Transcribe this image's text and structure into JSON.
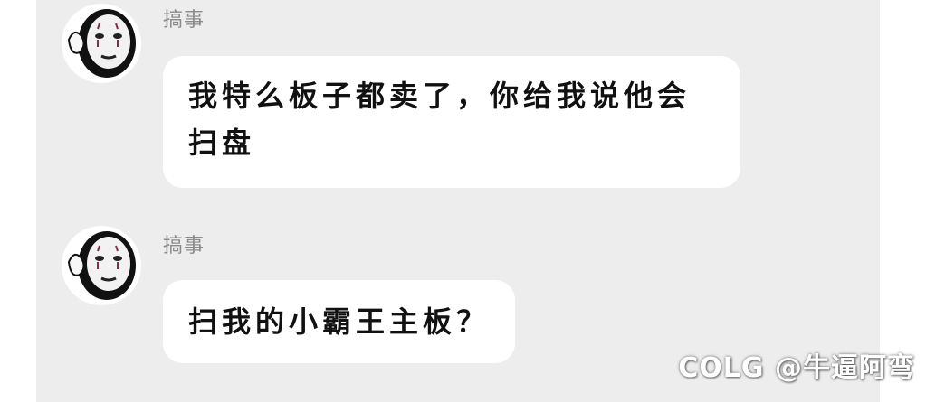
{
  "messages": [
    {
      "sender": "搞事",
      "avatar_icon": "no-face-avatar-icon",
      "text": "我特么板子都卖了，你给我说他会扫盘"
    },
    {
      "sender": "搞事",
      "avatar_icon": "no-face-avatar-icon",
      "text": "扫我的小霸王主板？"
    }
  ],
  "watermark": "COLG @牛逼阿弯",
  "colors": {
    "background": "#ededed",
    "bubble": "#ffffff",
    "sender_name": "#8a8a8a",
    "text": "#111111"
  }
}
